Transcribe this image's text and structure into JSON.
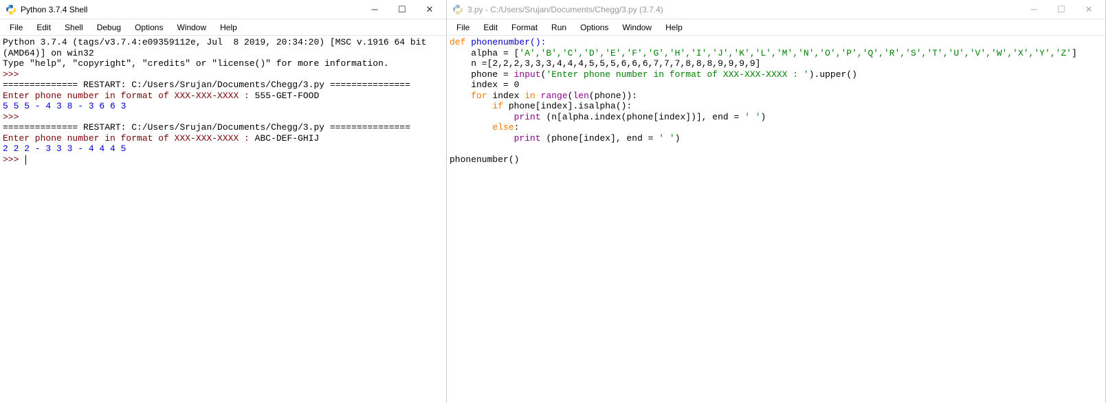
{
  "shell": {
    "title": "Python 3.7.4 Shell",
    "menus": [
      "File",
      "Edit",
      "Shell",
      "Debug",
      "Options",
      "Window",
      "Help"
    ],
    "header_line1": "Python 3.7.4 (tags/v3.7.4:e09359112e, Jul  8 2019, 20:34:20) [MSC v.1916 64 bit",
    "header_line2": "(AMD64)] on win32",
    "header_line3": "Type \"help\", \"copyright\", \"credits\" or \"license()\" for more information.",
    "prompt": ">>>",
    "restart1": "============== RESTART: C:/Users/Srujan/Documents/Chegg/3.py ===============",
    "prompt1": "Enter phone number in format of XXX-XXX-XXXX : ",
    "input1": "555-GET-FOOD",
    "output1": "5 5 5 - 4 3 8 - 3 6 6 3 ",
    "restart2": "============== RESTART: C:/Users/Srujan/Documents/Chegg/3.py ===============",
    "prompt2": "Enter phone number in format of XXX-XXX-XXXX : ",
    "input2": "ABC-DEF-GHIJ",
    "output2": "2 2 2 - 3 3 3 - 4 4 4 5 "
  },
  "editor": {
    "title": "3.py - C:/Users/Srujan/Documents/Chegg/3.py (3.7.4)",
    "menus": [
      "File",
      "Edit",
      "Format",
      "Run",
      "Options",
      "Window",
      "Help"
    ],
    "code": {
      "l1_def": "def",
      "l1_rest": " phonenumber():",
      "l2a": "    alpha = [",
      "l2b": "'A','B','C','D','E','F','G','H','I','J','K','L','M','N','O','P','Q','R','S','T','U','V','W','X','Y','Z'",
      "l2c": "]",
      "l3": "    n =[2,2,2,3,3,3,4,4,4,5,5,5,6,6,6,7,7,7,8,8,8,9,9,9,9]",
      "l4a": "    phone = ",
      "l4b": "input",
      "l4c": "(",
      "l4d": "'Enter phone number in format of XXX-XXX-XXXX : '",
      "l4e": ").upper()",
      "l5": "    index = 0",
      "l6a": "    ",
      "l6_for": "for",
      "l6b": " index ",
      "l6_in": "in",
      "l6c": " ",
      "l6_range": "range",
      "l6d": "(",
      "l6_len": "len",
      "l6e": "(phone)):",
      "l7a": "        ",
      "l7_if": "if",
      "l7b": " phone[index].isalpha():",
      "l8a": "            ",
      "l8_print": "print",
      "l8b": " (n[alpha.index(phone[index])], end = ",
      "l8c": "' '",
      "l8d": ")",
      "l9a": "        ",
      "l9_else": "else",
      "l9b": ":",
      "l10a": "            ",
      "l10_print": "print",
      "l10b": " (phone[index], end = ",
      "l10c": "' '",
      "l10d": ")",
      "l11": "",
      "l12": "phonenumber()"
    }
  }
}
